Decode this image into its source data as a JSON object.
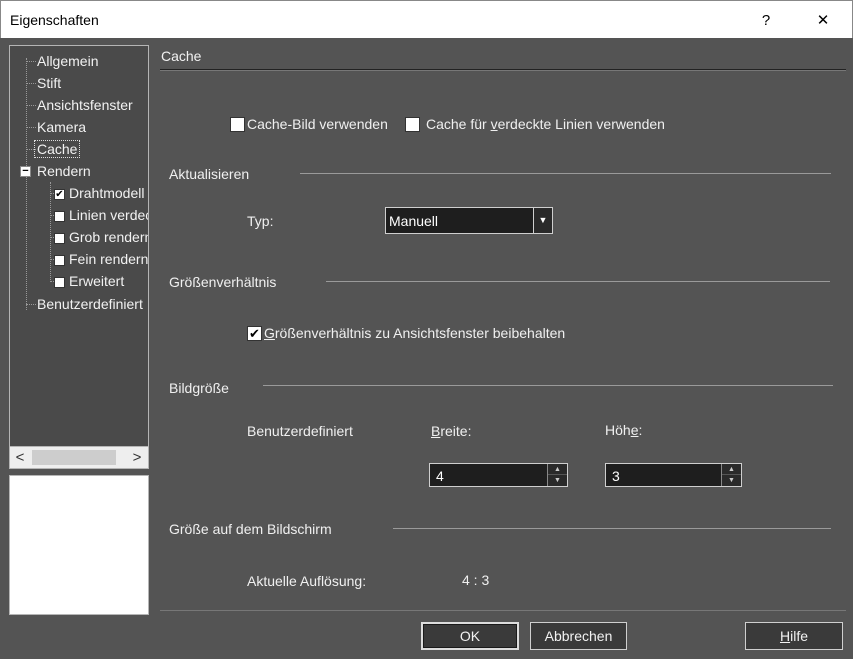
{
  "window": {
    "title": "Eigenschaften",
    "help_glyph": "?",
    "close_glyph": "✕"
  },
  "tree": {
    "items": [
      {
        "label": "Allgemein"
      },
      {
        "label": "Stift"
      },
      {
        "label": "Ansichtsfenster"
      },
      {
        "label": "Kamera"
      },
      {
        "label": "Cache",
        "selected": true
      },
      {
        "label": "Rendern",
        "expanded": true
      },
      {
        "label": "Drahtmodell",
        "checked": true
      },
      {
        "label": "Linien verdeckt",
        "checked": false
      },
      {
        "label": "Grob rendern",
        "checked": false
      },
      {
        "label": "Fein rendern",
        "checked": false
      },
      {
        "label": "Erweitert",
        "checked": false
      },
      {
        "label": "Benutzerdefiniert"
      }
    ],
    "scroll_left": "<",
    "scroll_right": ">",
    "expander_glyph": "−",
    "check_glyph": "✔"
  },
  "panel": {
    "title": "Cache",
    "use_cache_image": {
      "label": "Cache-Bild verwenden",
      "checked": false
    },
    "cache_hidden_lines": {
      "label_pre": "Cache für ",
      "label_u": "v",
      "label_post": "erdeckte Linien verwenden",
      "checked": false
    },
    "update": {
      "section": "Aktualisieren",
      "type_label": "Typ:",
      "type_value": "Manuell",
      "dropdown_glyph": "▼"
    },
    "aspect": {
      "section": "Größenverhältnis",
      "keep_label": "Größenverhältnis zu Ansichtsfenster beibehalten",
      "keep_u": "G",
      "keep_rest": "rößenverhältnis zu Ansichtsfenster beibehalten",
      "checked": true,
      "check_glyph": "✔"
    },
    "image_size": {
      "section": "Bildgröße",
      "custom_label": "Benutzerdefiniert",
      "width_u": "B",
      "width_rest": "reite:",
      "height_pre": "Höh",
      "height_u": "e",
      "height_post": ":",
      "width_value": "4",
      "height_value": "3",
      "spin_up": "▲",
      "spin_down": "▼"
    },
    "screen_size": {
      "section": "Größe auf dem Bildschirm",
      "resolution_label": "Aktuelle Auflösung:",
      "resolution_value": "4 : 3"
    }
  },
  "buttons": {
    "ok": "OK",
    "cancel": "Abbrechen",
    "help_u": "H",
    "help_rest": "ilfe"
  }
}
